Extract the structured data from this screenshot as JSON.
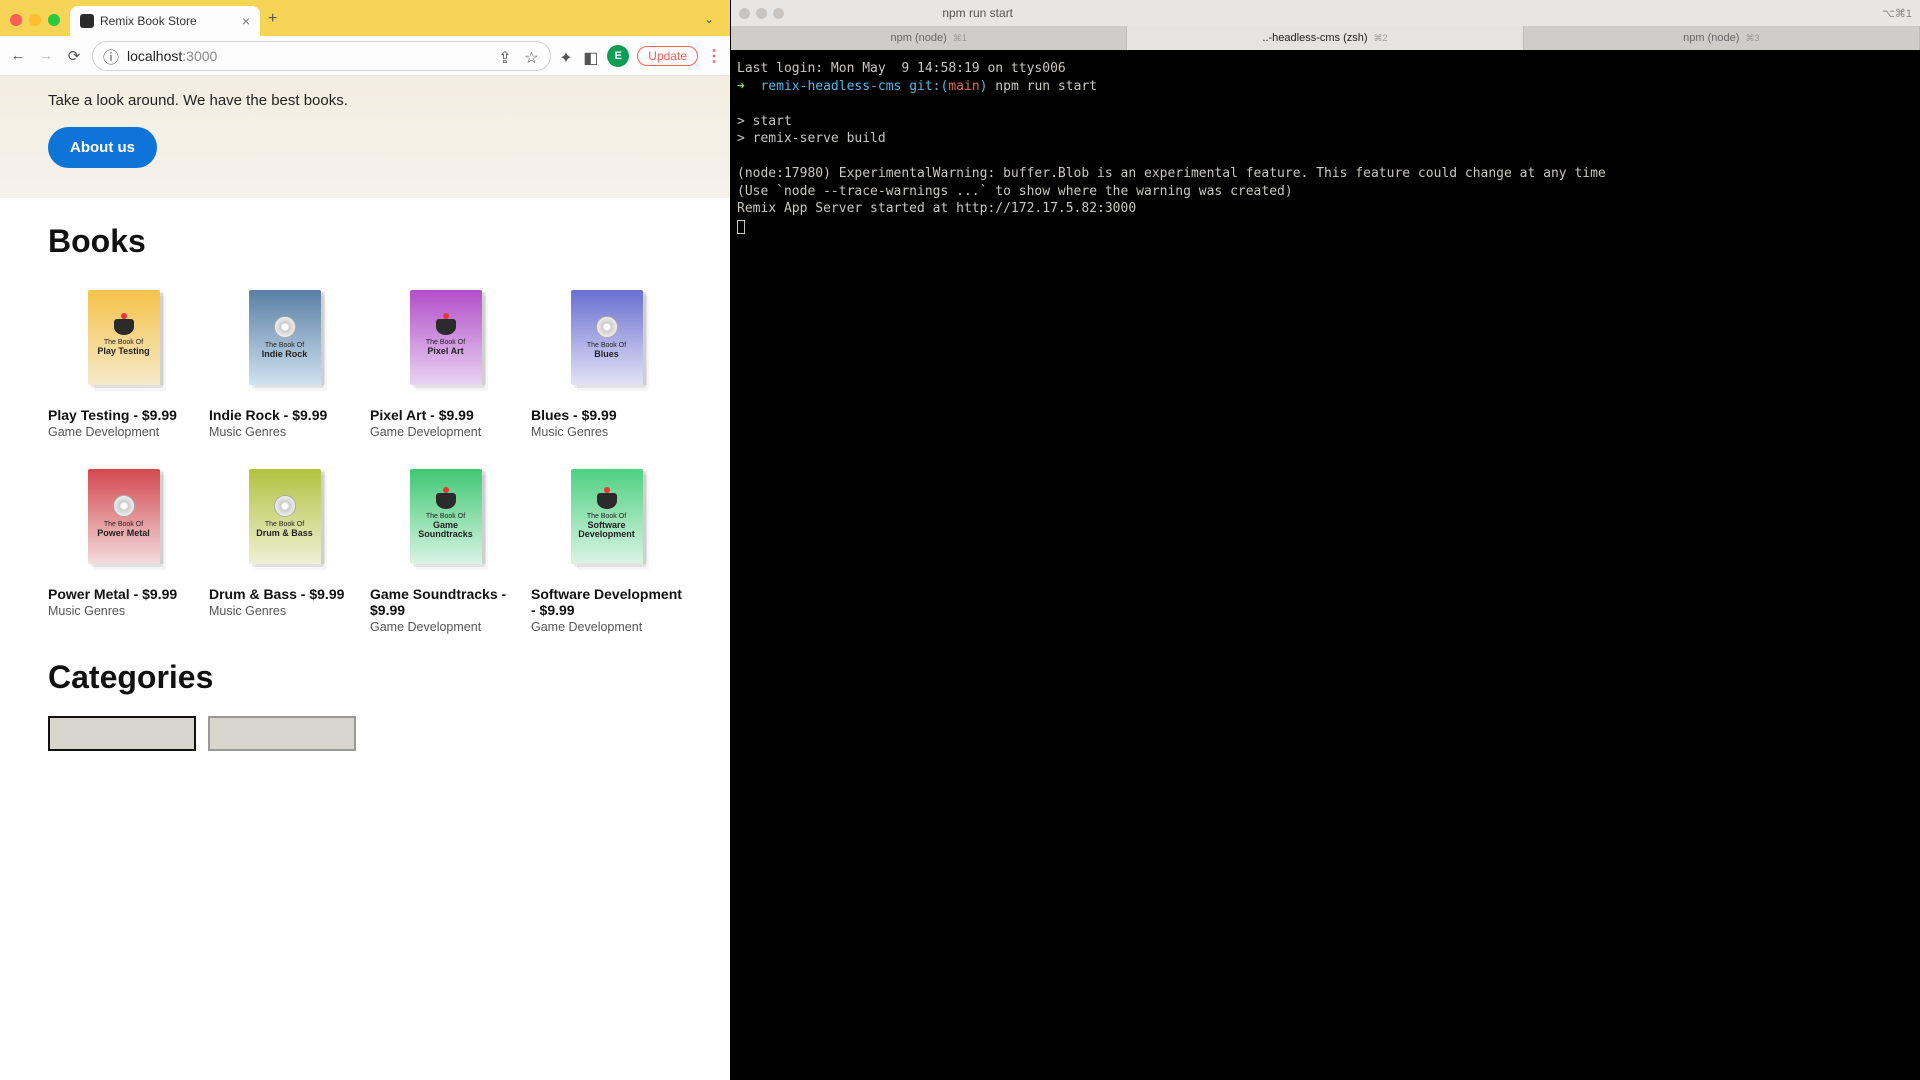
{
  "browser": {
    "tab_title": "Remix Book Store",
    "url_host": "localhost",
    "url_path": ":3000",
    "update_label": "Update",
    "avatar_letter": "E"
  },
  "page": {
    "hero_sub": "Take a look around. We have the best books.",
    "about_label": "About us",
    "section_books": "Books",
    "section_categories": "Categories",
    "cover_sublabel": "The Book Of",
    "books": [
      {
        "title": "Play Testing",
        "price": "$9.99",
        "category": "Game Development",
        "icon": "joy",
        "bg": "linear-gradient(180deg,#f6c24a,#f4e9c9)",
        "name": "Play Testing"
      },
      {
        "title": "Indie Rock",
        "price": "$9.99",
        "category": "Music Genres",
        "icon": "disc",
        "bg": "linear-gradient(180deg,#5a7fa5,#cfe2f0)",
        "name": "Indie Rock"
      },
      {
        "title": "Pixel Art",
        "price": "$9.99",
        "category": "Game Development",
        "icon": "joy",
        "bg": "linear-gradient(180deg,#b24fc9,#e9d2f2)",
        "name": "Pixel Art"
      },
      {
        "title": "Blues",
        "price": "$9.99",
        "category": "Music Genres",
        "icon": "disc",
        "bg": "linear-gradient(180deg,#6a6fd1,#e2e3f6)",
        "name": "Blues"
      },
      {
        "title": "Power Metal",
        "price": "$9.99",
        "category": "Music Genres",
        "icon": "disc",
        "bg": "linear-gradient(180deg,#d2484f,#f3dcdc)",
        "name": "Power Metal"
      },
      {
        "title": "Drum & Bass",
        "price": "$9.99",
        "category": "Music Genres",
        "icon": "disc",
        "bg": "linear-gradient(180deg,#b1c23f,#eef1d6)",
        "name": "Drum & Bass"
      },
      {
        "title": "Game Soundtracks",
        "price": "$9.99",
        "category": "Game Development",
        "icon": "joy",
        "bg": "linear-gradient(180deg,#3fc873,#d9f4e3)",
        "name": "Game Soundtracks"
      },
      {
        "title": "Software Development",
        "price": "$9.99",
        "category": "Game Development",
        "icon": "joy",
        "bg": "linear-gradient(180deg,#4fd181,#dbf4e4)",
        "name": "Software Development"
      }
    ]
  },
  "terminal": {
    "window_title": "npm run start",
    "right_icon_label": "⌥⌘1",
    "tabs": [
      {
        "label": "npm (node)",
        "shortcut": "⌘1",
        "active": false
      },
      {
        "label": "..-headless-cms (zsh)",
        "shortcut": "⌘2",
        "active": true
      },
      {
        "label": "npm (node)",
        "shortcut": "⌘3",
        "active": false
      }
    ],
    "line_login": "Last login: Mon May  9 14:58:19 on ttys006",
    "prompt_arrow": "➜  ",
    "prompt_dir": "remix-headless-cms",
    "prompt_git_label": "git:(",
    "prompt_git_branch": "main",
    "prompt_git_close": ")",
    "prompt_cmd": " npm run start",
    "line_start": "> start",
    "line_serve": "> remix-serve build",
    "line_warn": "(node:17980) ExperimentalWarning: buffer.Blob is an experimental feature. This feature could change at any time",
    "line_trace": "(Use `node --trace-warnings ...` to show where the warning was created)",
    "line_started": "Remix App Server started at http://172.17.5.82:3000"
  }
}
